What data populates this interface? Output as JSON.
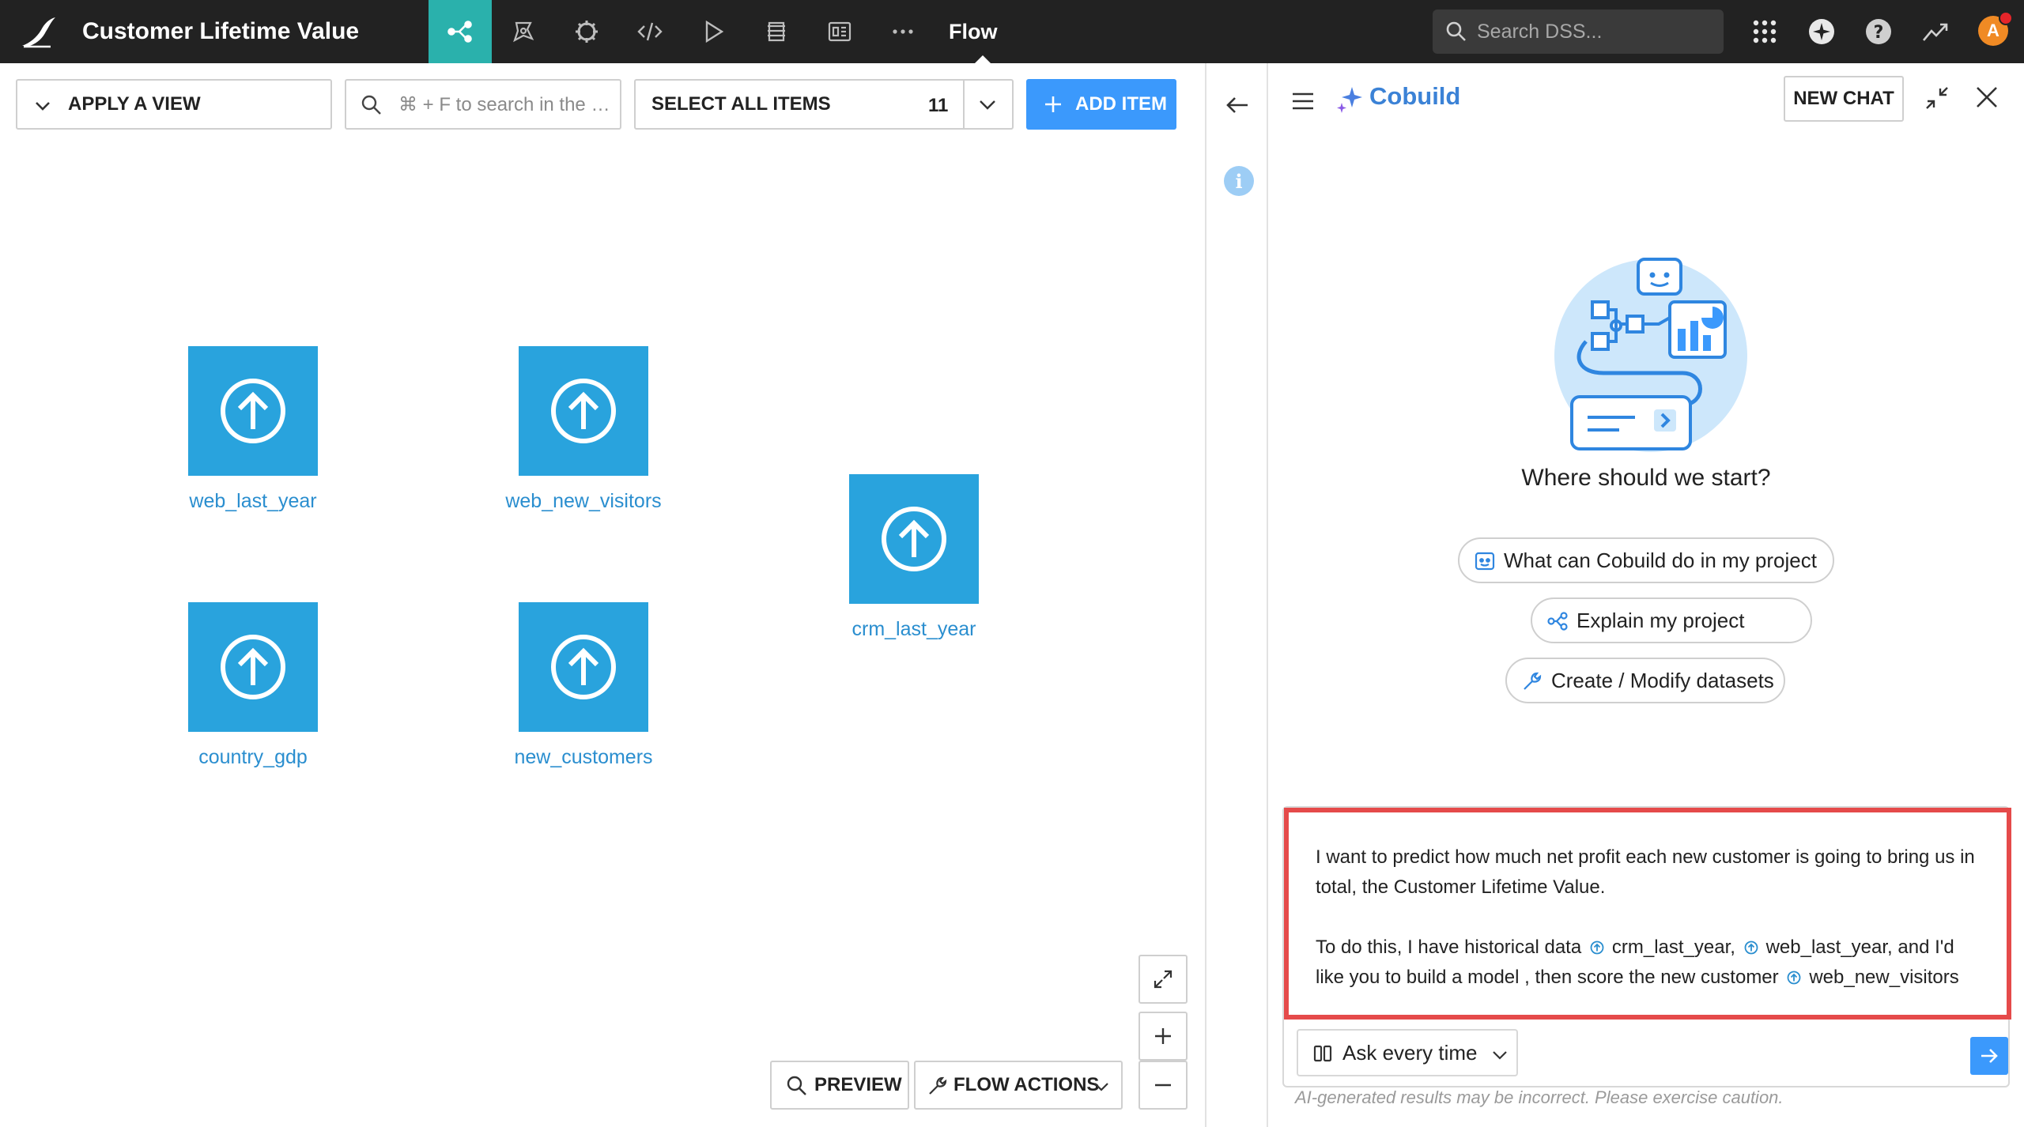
{
  "app": {
    "project_title": "Customer Lifetime Value",
    "current_section": "Flow"
  },
  "topnav": {
    "icons": [
      "flow-icon",
      "lab-icon",
      "gear-icon",
      "code-icon",
      "play-icon",
      "stack-icon",
      "dashboard-icon",
      "more-icon"
    ],
    "search_placeholder": "Search DSS...",
    "avatar_initial": "A"
  },
  "flow_toolbar": {
    "apply_view_label": "APPLY A VIEW",
    "search_placeholder": "⌘ + F to search in the Flow",
    "select_all_label": "SELECT ALL ITEMS",
    "item_count": "11",
    "add_item_label": "ADD ITEM"
  },
  "datasets": [
    {
      "name": "web_last_year"
    },
    {
      "name": "web_new_visitors"
    },
    {
      "name": "crm_last_year"
    },
    {
      "name": "country_gdp"
    },
    {
      "name": "new_customers"
    }
  ],
  "flow_bottom": {
    "preview_label": "PREVIEW",
    "flow_actions_label": "FLOW ACTIONS"
  },
  "cobuild": {
    "title": "Cobuild",
    "new_chat_label": "NEW CHAT",
    "heading": "Where should we start?",
    "suggestions": [
      {
        "label": "What can Cobuild do in my project",
        "icon": "bot-icon"
      },
      {
        "label": "Explain my project",
        "icon": "flow-icon"
      },
      {
        "label": "Create / Modify datasets",
        "icon": "wrench-icon"
      }
    ],
    "prompt": {
      "p1": "I want to predict how much net profit each new customer is going to bring us in total, the Customer Lifetime Value.",
      "p2_a": "To do this, I have historical data",
      "ref1": "crm_last_year,",
      "ref2": "web_last_year,",
      "p2_b": "and I'd like you to build a model , then score the new customer",
      "ref3": "web_new_visitors"
    },
    "mode_label": "Ask every time",
    "disclaimer": "AI-generated results may be incorrect. Please exercise caution."
  },
  "colors": {
    "topbar": "#222222",
    "flow_accent": "#2ab1ac",
    "dataset_blue": "#29a3dd",
    "primary_button": "#3b99fc",
    "highlight_red": "#e54a4a"
  }
}
